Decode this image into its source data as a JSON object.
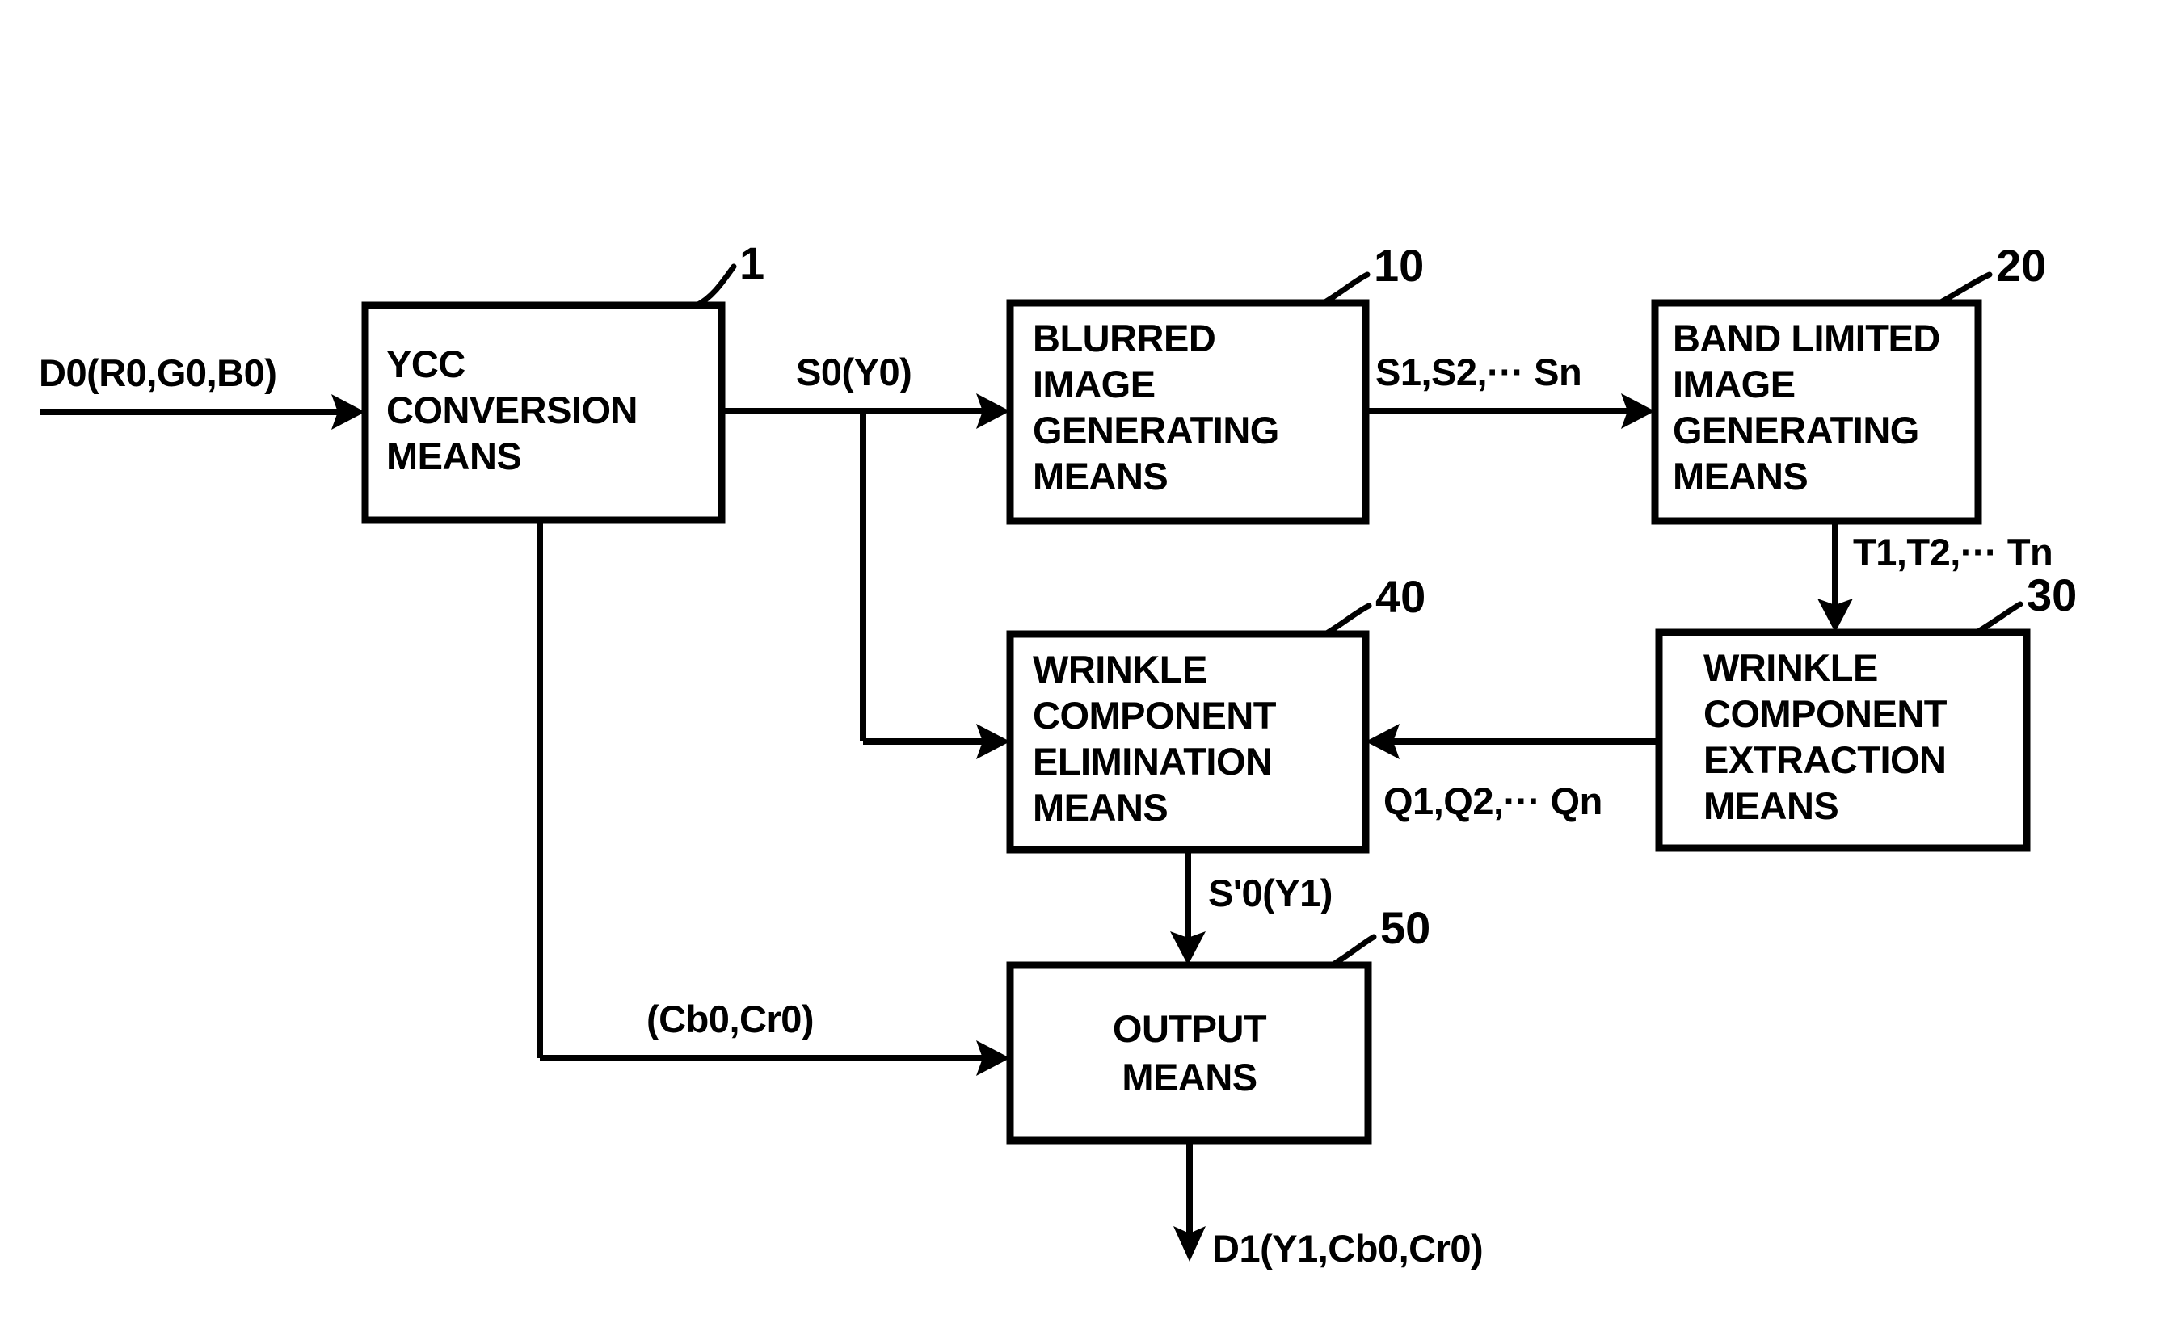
{
  "diagram": {
    "type": "block-diagram",
    "blocks": [
      {
        "ref": "1",
        "name": "ycc-conversion-means",
        "lines": [
          "YCC",
          "CONVERSION",
          "MEANS"
        ],
        "line1": "YCC",
        "line2": "CONVERSION",
        "line3": "MEANS"
      },
      {
        "ref": "10",
        "name": "blurred-image-generating-means",
        "lines": [
          "BLURRED",
          "IMAGE",
          "GENERATING",
          "MEANS"
        ],
        "line1": "BLURRED",
        "line2": "IMAGE",
        "line3": "GENERATING",
        "line4": "MEANS"
      },
      {
        "ref": "20",
        "name": "band-limited-image-generating-means",
        "lines": [
          "BAND LIMITED",
          "IMAGE",
          "GENERATING",
          "MEANS"
        ],
        "line1": "BAND LIMITED",
        "line2": "IMAGE",
        "line3": "GENERATING",
        "line4": "MEANS"
      },
      {
        "ref": "30",
        "name": "wrinkle-component-extraction-means",
        "lines": [
          "WRINKLE",
          "COMPONENT",
          "EXTRACTION",
          "MEANS"
        ],
        "line1": "WRINKLE",
        "line2": "COMPONENT",
        "line3": "EXTRACTION",
        "line4": "MEANS"
      },
      {
        "ref": "40",
        "name": "wrinkle-component-elimination-means",
        "lines": [
          "WRINKLE",
          "COMPONENT",
          "ELIMINATION",
          "MEANS"
        ],
        "line1": "WRINKLE",
        "line2": "COMPONENT",
        "line3": "ELIMINATION",
        "line4": "MEANS"
      },
      {
        "ref": "50",
        "name": "output-means",
        "lines": [
          "OUTPUT",
          "MEANS"
        ],
        "line1": "OUTPUT",
        "line2": "MEANS"
      }
    ],
    "signals": {
      "input": "D0(R0,G0,B0)",
      "s0": "S0(Y0)",
      "s_series": "S1,S2,··· Sn",
      "t_series": "T1,T2,··· Tn",
      "q_series": "Q1,Q2,··· Qn",
      "s0_prime": "S'0(Y1)",
      "chroma": "(Cb0,Cr0)",
      "output": "D1(Y1,Cb0,Cr0)"
    },
    "ref_numbers": {
      "ycc": "1",
      "blurred": "10",
      "band_limited": "20",
      "extraction": "30",
      "elimination": "40",
      "output": "50"
    },
    "colors": {
      "line": "#000000",
      "background": "#ffffff",
      "box_fill": "#ffffff"
    }
  }
}
